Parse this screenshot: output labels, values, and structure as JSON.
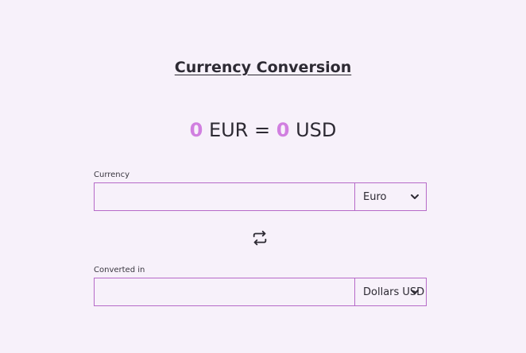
{
  "title": "Currency Conversion",
  "rate": {
    "amount_from": "0",
    "currency_from": "EUR",
    "equals": "=",
    "amount_to": "0",
    "currency_to": "USD"
  },
  "source": {
    "label": "Currency",
    "value": "",
    "selected": "Euro",
    "icon": "chevron-down-icon"
  },
  "swap": {
    "icon": "swap-arrows-icon"
  },
  "target": {
    "label": "Converted in",
    "value": "",
    "selected": "Dollars USD",
    "icon": "chevron-down-icon"
  },
  "colors": {
    "background": "#f7f1fa",
    "accent": "#d17fe0",
    "border": "#b66ac8",
    "text": "#2d2a33"
  }
}
